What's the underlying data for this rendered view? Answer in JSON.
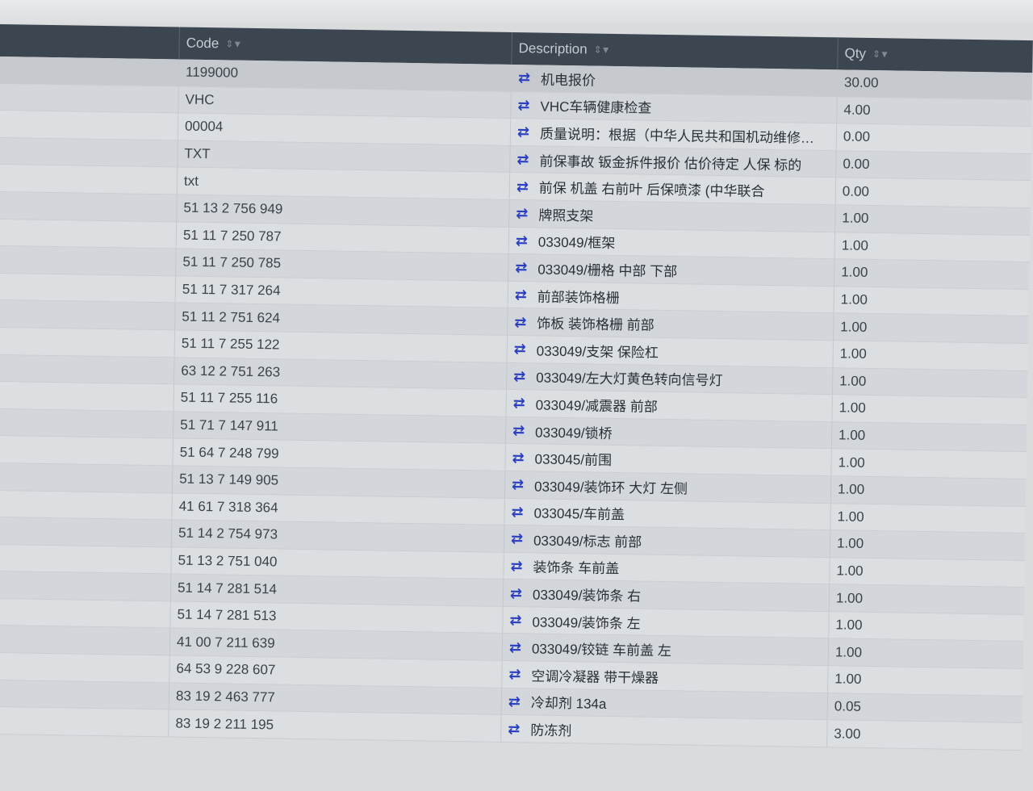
{
  "table": {
    "columns": [
      {
        "label": "Code"
      },
      {
        "label": "Description"
      },
      {
        "label": "Qty"
      }
    ],
    "rows": [
      {
        "code": "1199000",
        "description": "机电报价",
        "qty": "30.00"
      },
      {
        "code": "VHC",
        "description": "VHC车辆健康检查",
        "qty": "4.00"
      },
      {
        "code": "00004",
        "description": "质量说明：根据（中华人民共和国机动维修…",
        "qty": "0.00"
      },
      {
        "code": "TXT",
        "description": "前保事故 钣金拆件报价 估价待定 人保 标的",
        "qty": "0.00"
      },
      {
        "code": "txt",
        "description": "前保 机盖 右前叶 后保喷漆 (中华联合",
        "qty": "0.00"
      },
      {
        "code": "51 13 2 756 949",
        "description": "牌照支架",
        "qty": "1.00"
      },
      {
        "code": "51 11 7 250 787",
        "description": "033049/框架",
        "qty": "1.00"
      },
      {
        "code": "51 11 7 250 785",
        "description": "033049/栅格 中部 下部",
        "qty": "1.00"
      },
      {
        "code": "51 11 7 317 264",
        "description": "前部装饰格栅",
        "qty": "1.00"
      },
      {
        "code": "51 11 2 751 624",
        "description": "饰板 装饰格栅 前部",
        "qty": "1.00"
      },
      {
        "code": "51 11 7 255 122",
        "description": "033049/支架 保险杠",
        "qty": "1.00"
      },
      {
        "code": "63 12 2 751 263",
        "description": "033049/左大灯黄色转向信号灯",
        "qty": "1.00"
      },
      {
        "code": "51 11 7 255 116",
        "description": "033049/减震器 前部",
        "qty": "1.00"
      },
      {
        "code": "51 71 7 147 911",
        "description": "033049/锁桥",
        "qty": "1.00"
      },
      {
        "code": "51 64 7 248 799",
        "description": "033045/前围",
        "qty": "1.00"
      },
      {
        "code": "51 13 7 149 905",
        "description": "033049/装饰环 大灯 左侧",
        "qty": "1.00"
      },
      {
        "code": "41 61 7 318 364",
        "description": "033045/车前盖",
        "qty": "1.00"
      },
      {
        "code": "51 14 2 754 973",
        "description": "033049/标志 前部",
        "qty": "1.00"
      },
      {
        "code": "51 13 2 751 040",
        "description": "装饰条 车前盖",
        "qty": "1.00"
      },
      {
        "code": "51 14 7 281 514",
        "description": "033049/装饰条 右",
        "qty": "1.00"
      },
      {
        "code": "51 14 7 281 513",
        "description": "033049/装饰条 左",
        "qty": "1.00"
      },
      {
        "code": "41 00 7 211 639",
        "description": "033049/铰链 车前盖 左",
        "qty": "1.00"
      },
      {
        "code": "64 53 9 228 607",
        "description": "空调冷凝器 带干燥器",
        "qty": "1.00"
      },
      {
        "code": "83 19 2 463 777",
        "description": "冷却剂 134a",
        "qty": "0.05"
      },
      {
        "code": "83 19 2 211 195",
        "description": "防冻剂",
        "qty": "3.00"
      }
    ]
  },
  "icons": {
    "sort": "sort-filter-icon",
    "row_action": "swap-arrows-icon"
  },
  "colors": {
    "header_bg": "#3b4650",
    "header_text": "#c7ccd2",
    "icon_accent": "#2a3ec2"
  }
}
